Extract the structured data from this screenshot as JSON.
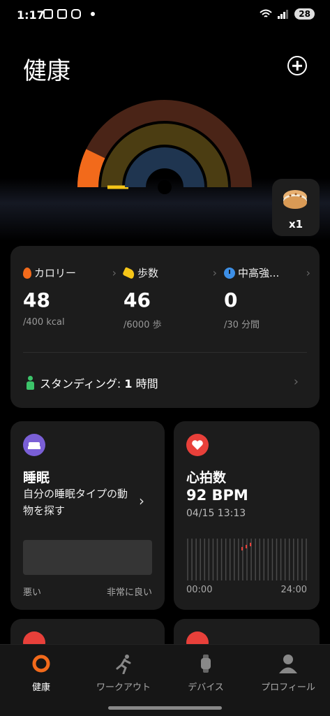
{
  "status_bar": {
    "time": "1:17",
    "battery": "28"
  },
  "header": {
    "title": "健康"
  },
  "reward": {
    "count": "x1"
  },
  "activity": {
    "metrics": [
      {
        "label": "カロリー",
        "value": "48",
        "goal": "/400 kcal",
        "color": "#f26a1b"
      },
      {
        "label": "歩数",
        "value": "46",
        "goal": "/6000 歩",
        "color": "#f5c518"
      },
      {
        "label": "中高強...",
        "value": "0",
        "goal": "/30 分間",
        "color": "#3d8fe6"
      }
    ],
    "standing": {
      "label": "スタンディング: ",
      "value": "1",
      "unit": " 時間"
    }
  },
  "sleep": {
    "title": "睡眠",
    "description": "自分の睡眠タイプの動物を探す",
    "scale_low": "悪い",
    "scale_high": "非常に良い"
  },
  "heart_rate": {
    "title": "心拍数",
    "value": "92 BPM",
    "timestamp": "04/15 13:13",
    "axis_start": "00:00",
    "axis_end": "24:00"
  },
  "nav": {
    "items": [
      {
        "label": "健康",
        "active": true
      },
      {
        "label": "ワークアウト",
        "active": false
      },
      {
        "label": "デバイス",
        "active": false
      },
      {
        "label": "プロフィール",
        "active": false
      }
    ]
  },
  "colors": {
    "calorie": "#f26a1b",
    "steps": "#f5c518",
    "intensity": "#3d8fe6",
    "standing": "#3cc46a",
    "sleep_icon": "#7a5fd6",
    "heart_icon": "#e8403a"
  }
}
